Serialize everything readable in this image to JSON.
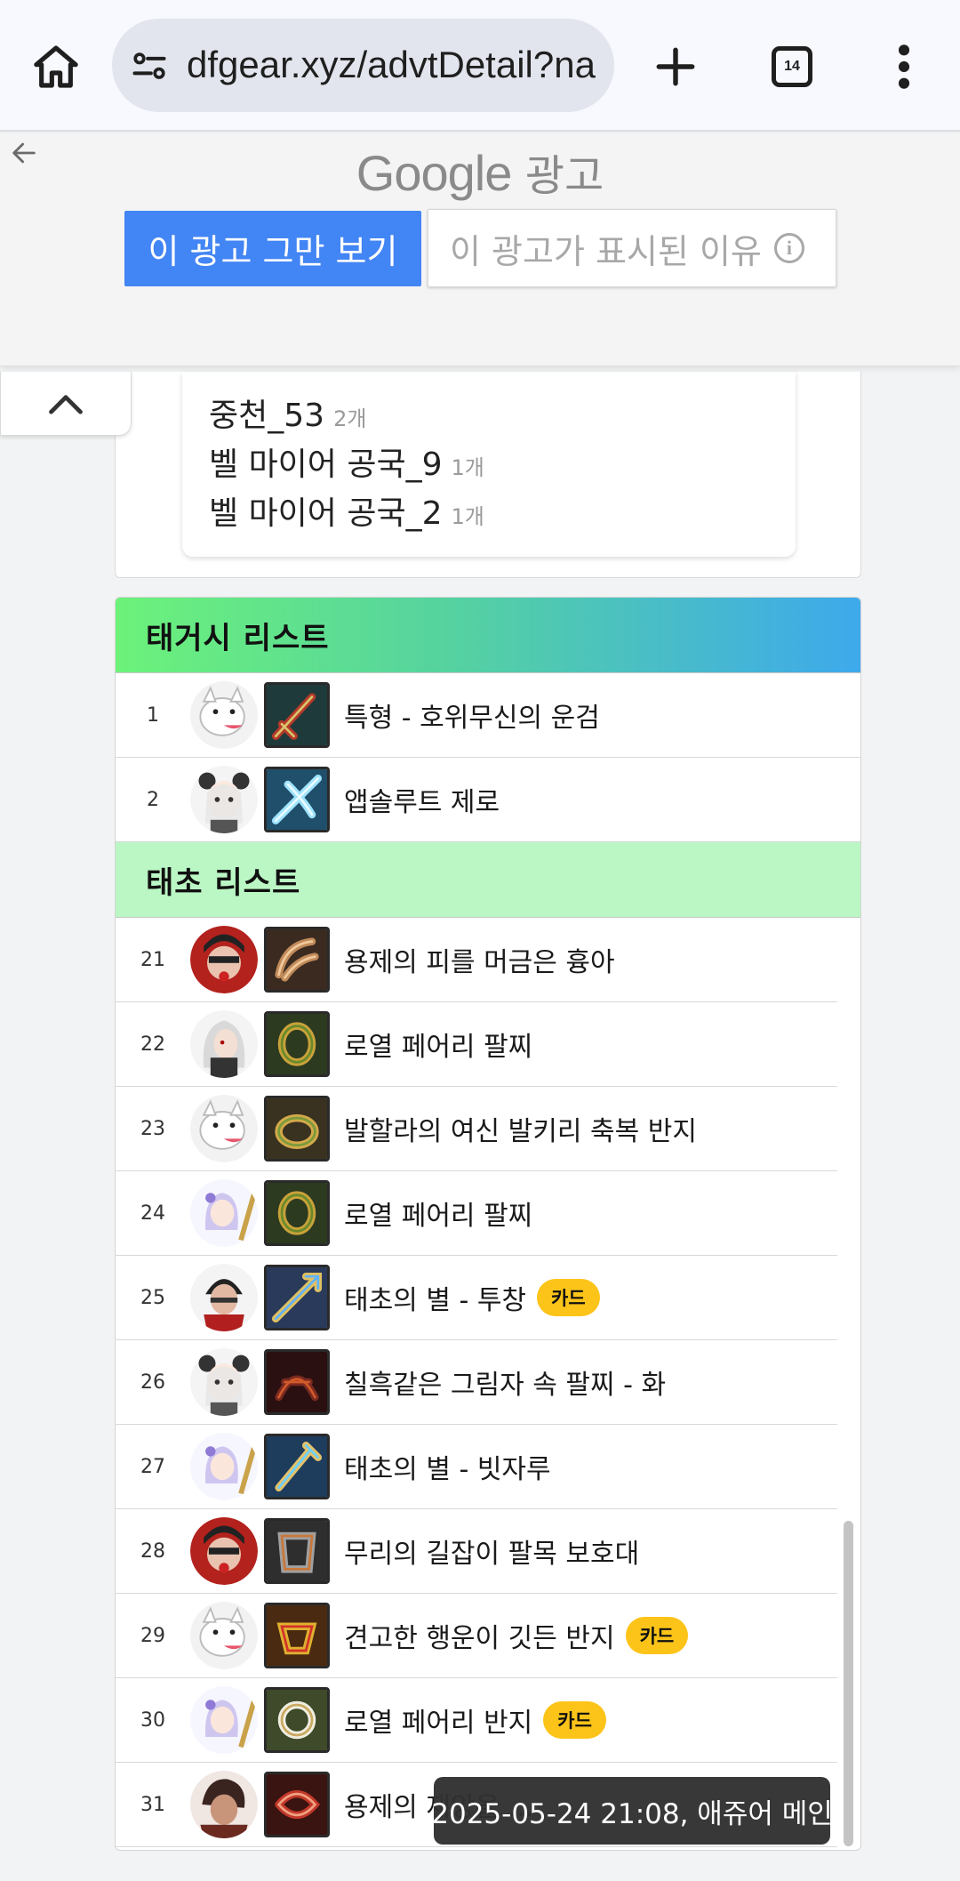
{
  "browser": {
    "url": "dfgear.xyz/advtDetail?na",
    "tab_count": "14"
  },
  "ad": {
    "brand": "Google",
    "label": "광고",
    "stop_button": "이 광고 그만 보기",
    "why_button": "이 광고가 표시된 이유"
  },
  "stack_items": [
    {
      "name": "중천_53",
      "count": "2개"
    },
    {
      "name": "벨 마이어 공국_9",
      "count": "1개"
    },
    {
      "name": "벨 마이어 공국_2",
      "count": "1개"
    }
  ],
  "tagsi": {
    "title": "태거시 리스트",
    "rows": [
      {
        "num": "1",
        "name": "특형 - 호위무신의 운검",
        "badge": "",
        "avatar": "wolf",
        "icon": "sword"
      },
      {
        "num": "2",
        "name": "앱솔루트 제로",
        "badge": "",
        "avatar": "girl-panda",
        "icon": "ice"
      }
    ]
  },
  "taecho": {
    "title": "태초 리스트",
    "rows": [
      {
        "num": "21",
        "name": "용제의 피를 머금은 흉아",
        "badge": "",
        "avatar": "red-fighter",
        "icon": "claw"
      },
      {
        "num": "22",
        "name": "로열 페어리 팔찌",
        "badge": "",
        "avatar": "silver-hair",
        "icon": "bracelet"
      },
      {
        "num": "23",
        "name": "발할라의 여신 발키리 축복 반지",
        "badge": "",
        "avatar": "wolf",
        "icon": "ring-gold"
      },
      {
        "num": "24",
        "name": "로열 페어리 팔찌",
        "badge": "",
        "avatar": "mage-girl",
        "icon": "bracelet"
      },
      {
        "num": "25",
        "name": "태초의 별 - 투창",
        "badge": "카드",
        "avatar": "dark-warrior",
        "icon": "spear"
      },
      {
        "num": "26",
        "name": "칠흑같은 그림자 속 팔찌 - 화",
        "badge": "",
        "avatar": "girl-panda",
        "icon": "dark"
      },
      {
        "num": "27",
        "name": "태초의 별 - 빗자루",
        "badge": "",
        "avatar": "mage-girl",
        "icon": "broom"
      },
      {
        "num": "28",
        "name": "무리의 길잡이 팔목 보호대",
        "badge": "",
        "avatar": "red-fighter",
        "icon": "guard"
      },
      {
        "num": "29",
        "name": "견고한 행운이 깃든 반지",
        "badge": "카드",
        "avatar": "wolf",
        "icon": "ring-red"
      },
      {
        "num": "30",
        "name": "로열 페어리 반지",
        "badge": "카드",
        "avatar": "mage-girl",
        "icon": "ring-white"
      },
      {
        "num": "31",
        "name": "용제의 재앙을 ...",
        "badge": "",
        "avatar": "brawler",
        "icon": "red-band"
      }
    ]
  },
  "toast": "2025-05-24 21:08, 애쥬어 메인",
  "colors": {
    "ad_button_blue": "#4285f4",
    "card_badge_yellow": "#fcc419",
    "tagsi_gradient_start": "#6cf27a",
    "tagsi_gradient_end": "#3ea9ec",
    "taecho_header_green": "#bbf7c4"
  }
}
